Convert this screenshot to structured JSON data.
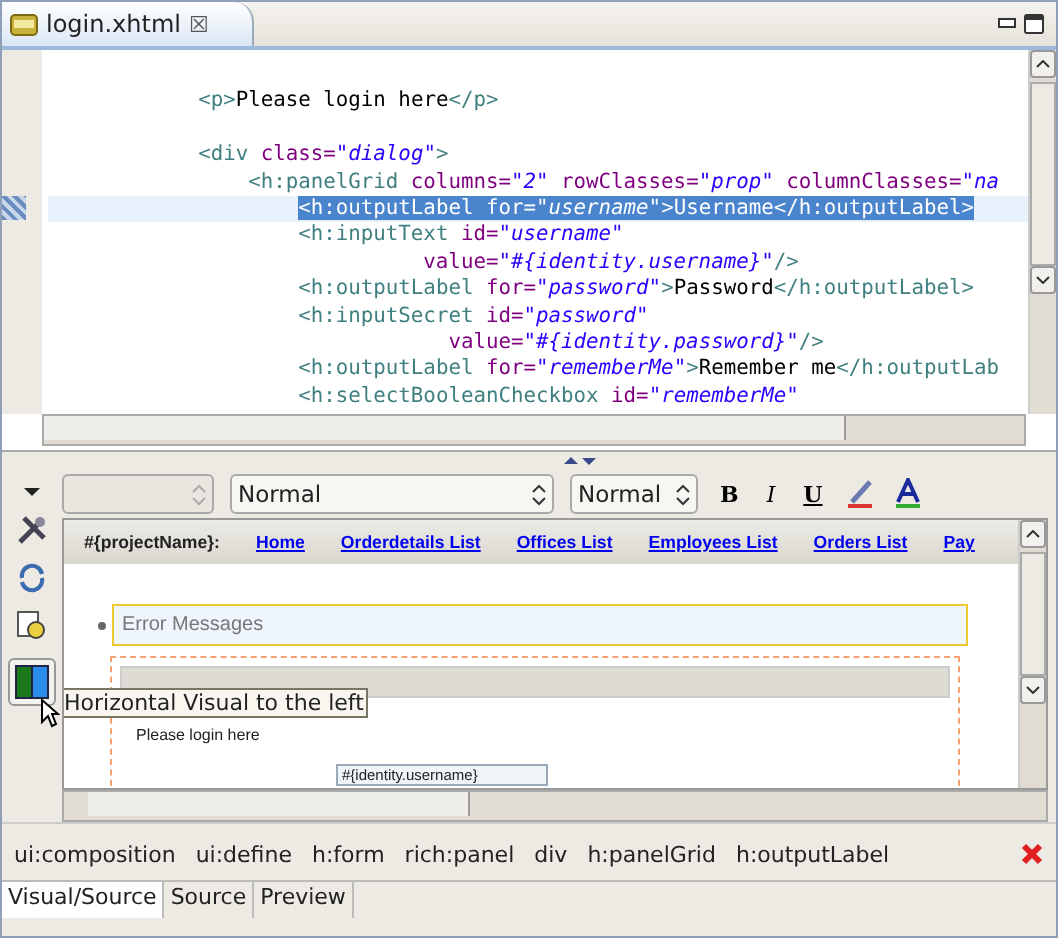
{
  "editor_tab": {
    "title": "login.xhtml",
    "close": "☒"
  },
  "code_lines": [
    {
      "selected": false
    },
    {
      "selected": false,
      "segments": [
        {
          "kind": "tag",
          "text": "            <p>"
        },
        {
          "kind": "text",
          "text": "Please login here"
        },
        {
          "kind": "tag",
          "text": "</p>"
        }
      ]
    },
    {
      "selected": false
    },
    {
      "selected": false,
      "segments": [
        {
          "kind": "tag",
          "text": "            <div "
        },
        {
          "kind": "attr",
          "text": "class="
        },
        {
          "kind": "value",
          "text": "\"dialog\""
        },
        {
          "kind": "tag",
          "text": ">"
        }
      ]
    },
    {
      "selected": false,
      "segments": [
        {
          "kind": "tag",
          "text": "                <h:panelGrid "
        },
        {
          "kind": "attr",
          "text": "columns="
        },
        {
          "kind": "value",
          "text": "\"2\""
        },
        {
          "kind": "attr",
          "text": " rowClasses="
        },
        {
          "kind": "value",
          "text": "\"prop\""
        },
        {
          "kind": "attr",
          "text": " columnClasses="
        },
        {
          "kind": "value",
          "text": "\"na"
        }
      ]
    },
    {
      "selected": true,
      "segments": [
        {
          "kind": "tag",
          "text": "                    <h:outputLabel "
        },
        {
          "kind": "attr",
          "text": "for="
        },
        {
          "kind": "value",
          "text": "\"username\""
        },
        {
          "kind": "tag",
          "text": ">"
        },
        {
          "kind": "text",
          "text": "Username"
        },
        {
          "kind": "tag",
          "text": "</h:outputLabel>"
        }
      ]
    },
    {
      "selected": false,
      "segments": [
        {
          "kind": "tag",
          "text": "                    <h:inputText "
        },
        {
          "kind": "attr",
          "text": "id="
        },
        {
          "kind": "value",
          "text": "\"username\""
        }
      ]
    },
    {
      "selected": false,
      "segments": [
        {
          "kind": "attr",
          "text": "                              value="
        },
        {
          "kind": "value",
          "text": "\"#{identity.username}\""
        },
        {
          "kind": "tag",
          "text": "/>"
        }
      ]
    },
    {
      "selected": false,
      "segments": [
        {
          "kind": "tag",
          "text": "                    <h:outputLabel "
        },
        {
          "kind": "attr",
          "text": "for="
        },
        {
          "kind": "value",
          "text": "\"password\""
        },
        {
          "kind": "tag",
          "text": ">"
        },
        {
          "kind": "text",
          "text": "Password"
        },
        {
          "kind": "tag",
          "text": "</h:outputLabel>"
        }
      ]
    },
    {
      "selected": false,
      "segments": [
        {
          "kind": "tag",
          "text": "                    <h:inputSecret "
        },
        {
          "kind": "attr",
          "text": "id="
        },
        {
          "kind": "value",
          "text": "\"password\""
        }
      ]
    },
    {
      "selected": false,
      "segments": [
        {
          "kind": "attr",
          "text": "                                value="
        },
        {
          "kind": "value",
          "text": "\"#{identity.password}\""
        },
        {
          "kind": "tag",
          "text": "/>"
        }
      ]
    },
    {
      "selected": false,
      "segments": [
        {
          "kind": "tag",
          "text": "                    <h:outputLabel "
        },
        {
          "kind": "attr",
          "text": "for="
        },
        {
          "kind": "value",
          "text": "\"rememberMe\""
        },
        {
          "kind": "tag",
          "text": ">"
        },
        {
          "kind": "text",
          "text": "Remember me"
        },
        {
          "kind": "tag",
          "text": "</h:outputLab"
        }
      ]
    },
    {
      "selected": false,
      "segments": [
        {
          "kind": "tag",
          "text": "                    <h:selectBooleanCheckbox "
        },
        {
          "kind": "attr",
          "text": "id="
        },
        {
          "kind": "value",
          "text": "\"rememberMe\""
        }
      ]
    }
  ],
  "format_toolbar": {
    "style_select": "Normal",
    "size_select": "Normal",
    "bold": "B",
    "italic": "I",
    "underline": "U"
  },
  "nav_bar": {
    "project": "#{projectName}:",
    "links": [
      "Home",
      "Orderdetails List",
      "Offices List",
      "Employees List",
      "Orders List",
      "Pay"
    ]
  },
  "error_messages": "Error Messages",
  "tooltip": "Horizontal Visual to the left",
  "page_text": "Please login here",
  "input_preview": "#{identity.username}",
  "breadcrumb": [
    "ui:composition",
    "ui:define",
    "h:form",
    "rich:panel",
    "div",
    "h:panelGrid",
    "h:outputLabel"
  ],
  "bottom_tabs": [
    {
      "label": "Visual/Source",
      "selected": true
    },
    {
      "label": "Source",
      "selected": false
    },
    {
      "label": "Preview",
      "selected": false
    }
  ]
}
